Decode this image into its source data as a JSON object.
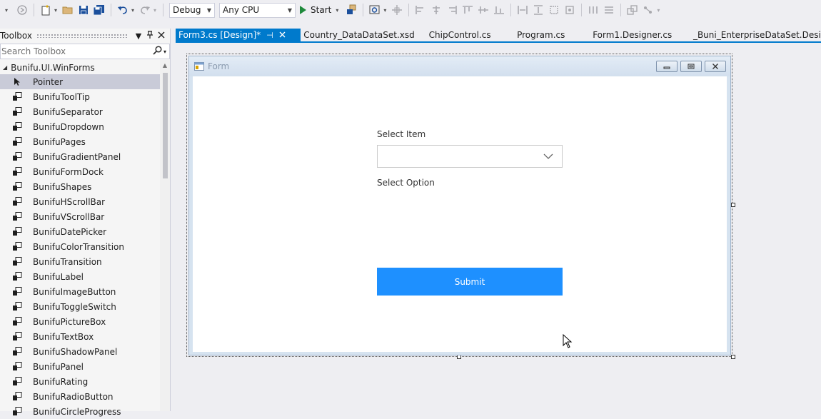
{
  "toolbar": {
    "configuration": "Debug",
    "platform": "Any CPU",
    "start_label": "Start"
  },
  "toolbox": {
    "title": "Toolbox",
    "search_placeholder": "Search Toolbox",
    "group": "Bunifu.UI.WinForms",
    "items": [
      {
        "label": "Pointer"
      },
      {
        "label": "BunifuToolTip"
      },
      {
        "label": "BunifuSeparator"
      },
      {
        "label": "BunifuDropdown"
      },
      {
        "label": "BunifuPages"
      },
      {
        "label": "BunifuGradientPanel"
      },
      {
        "label": "BunifuFormDock"
      },
      {
        "label": "BunifuShapes"
      },
      {
        "label": "BunifuHScrollBar"
      },
      {
        "label": "BunifuVScrollBar"
      },
      {
        "label": "BunifuDatePicker"
      },
      {
        "label": "BunifuColorTransition"
      },
      {
        "label": "BunifuTransition"
      },
      {
        "label": "BunifuLabel"
      },
      {
        "label": "BunifuImageButton"
      },
      {
        "label": "BunifuToggleSwitch"
      },
      {
        "label": "BunifuPictureBox"
      },
      {
        "label": "BunifuTextBox"
      },
      {
        "label": "BunifuShadowPanel"
      },
      {
        "label": "BunifuPanel"
      },
      {
        "label": "BunifuRating"
      },
      {
        "label": "BunifuRadioButton"
      },
      {
        "label": "BunifuCircleProgress"
      }
    ]
  },
  "tabs": [
    {
      "label": "Form3.cs [Design]*"
    },
    {
      "label": "Country_DataDataSet.xsd"
    },
    {
      "label": "ChipControl.cs"
    },
    {
      "label": "Program.cs"
    },
    {
      "label": "Form1.Designer.cs"
    },
    {
      "label": "_Buni_EnterpriseDataSet.Designer.cs"
    }
  ],
  "form": {
    "title": "Form",
    "select_item_label": "Select Item",
    "select_option_label": "Select Option",
    "dropdown_value": "",
    "submit_label": "Submit"
  },
  "colors": {
    "accent": "#007acc",
    "submit": "#1e90ff"
  }
}
